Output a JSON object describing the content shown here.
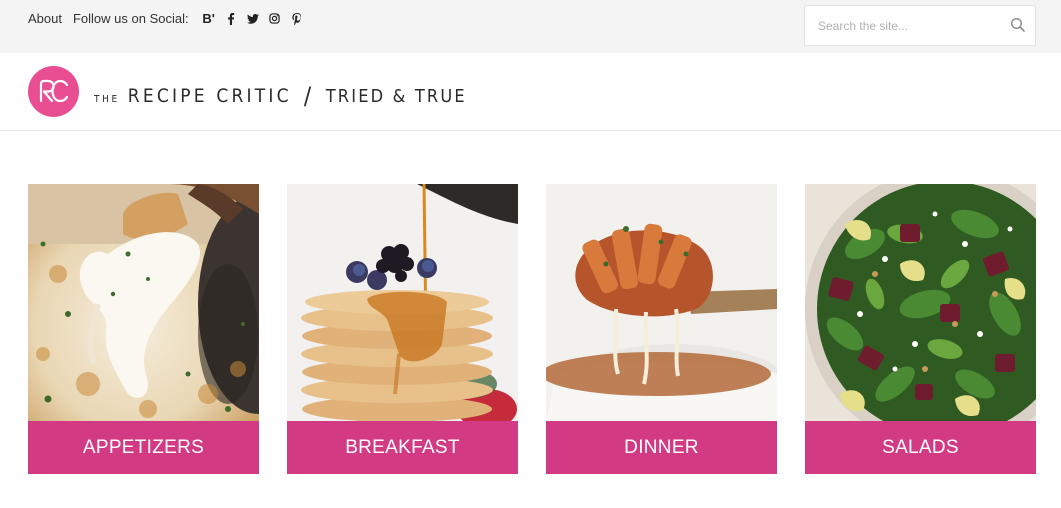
{
  "topbar": {
    "about": "About",
    "follow": "Follow us on Social:",
    "social": [
      {
        "icon": "bloglovin-icon",
        "glyph": "B'"
      },
      {
        "icon": "facebook-icon"
      },
      {
        "icon": "twitter-icon"
      },
      {
        "icon": "instagram-icon"
      },
      {
        "icon": "pinterest-icon"
      }
    ]
  },
  "search": {
    "placeholder": "Search the site...",
    "icon": "search-icon"
  },
  "logo": {
    "monogram": "RC",
    "the": "THE",
    "brand": "RECIPE CRITIC",
    "slash": "/",
    "tagline": "TRIED & TRUE",
    "color": "#e94e93"
  },
  "categories": [
    {
      "label": "APPETIZERS"
    },
    {
      "label": "BREAKFAST"
    },
    {
      "label": "DINNER"
    },
    {
      "label": "SALADS"
    }
  ],
  "colors": {
    "accent": "#e94e93",
    "label_bg": "#d33a84",
    "topbar_bg": "#f4f4f4"
  }
}
